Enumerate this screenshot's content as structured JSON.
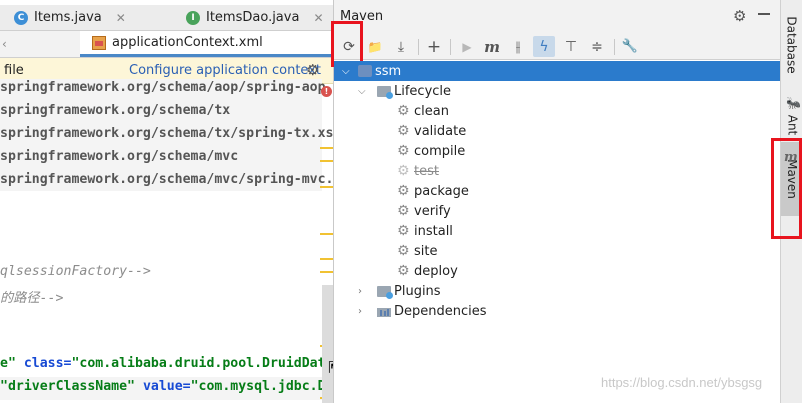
{
  "editor": {
    "tabs_row1": [
      {
        "label": "Items.java",
        "icon": "class-c-icon",
        "icon_color": "#3d8fd6",
        "icon_letter": "C"
      },
      {
        "label": "ItemsDao.java",
        "icon": "interface-i-icon",
        "icon_color": "#49a35b",
        "icon_letter": "I"
      }
    ],
    "active_tab": {
      "label": "applicationContext.xml",
      "icon": "xml-file-icon"
    },
    "banner": {
      "text": "file",
      "link": "Configure application context"
    },
    "code_lines": [
      "springframework.org/schema/aop/spring-aop",
      "springframework.org/schema/tx",
      "springframework.org/schema/tx/spring-tx.xs",
      "springframework.org/schema/mvc",
      "springframework.org/schema/mvc/spring-mvc."
    ],
    "comment1": "qlsessionFactory-->",
    "comment2": "的路径-->",
    "line_druid_attr1": "e\"",
    "line_druid_attr2": "class=",
    "line_druid_str": "\"com.alibaba.druid.pool.DruidDat",
    "line_driver_str1": "\"driverClassName\"",
    "line_driver_attr": "value=",
    "line_driver_str2": "\"com.mysql.jdbc.Dr"
  },
  "maven": {
    "title": "Maven",
    "toolbar": [
      {
        "name": "reload-icon",
        "glyph": "⟳"
      },
      {
        "name": "add-folder-icon",
        "glyph": "▬"
      },
      {
        "name": "download-icon",
        "glyph": "⤓"
      },
      {
        "name": "plus-icon",
        "glyph": "+"
      },
      {
        "name": "run-icon",
        "glyph": "▶"
      },
      {
        "name": "maven-goal-icon",
        "glyph": "m"
      },
      {
        "name": "toggle-offline-icon",
        "glyph": "⫲"
      },
      {
        "name": "skip-tests-icon",
        "glyph": "ϟ"
      },
      {
        "name": "show-dependencies-icon",
        "glyph": "⊤"
      },
      {
        "name": "collapse-all-icon",
        "glyph": "≑"
      },
      {
        "name": "settings-wrench-icon",
        "glyph": "🔧"
      }
    ],
    "tree": {
      "project": "ssm",
      "lifecycle_label": "Lifecycle",
      "goals": [
        "clean",
        "validate",
        "compile",
        "test",
        "package",
        "verify",
        "install",
        "site",
        "deploy"
      ],
      "plugins_label": "Plugins",
      "dependencies_label": "Dependencies"
    }
  },
  "strip": {
    "tabs": [
      "Database",
      "Ant",
      "Maven"
    ]
  },
  "watermark": "https://blog.csdn.net/ybsgsg"
}
